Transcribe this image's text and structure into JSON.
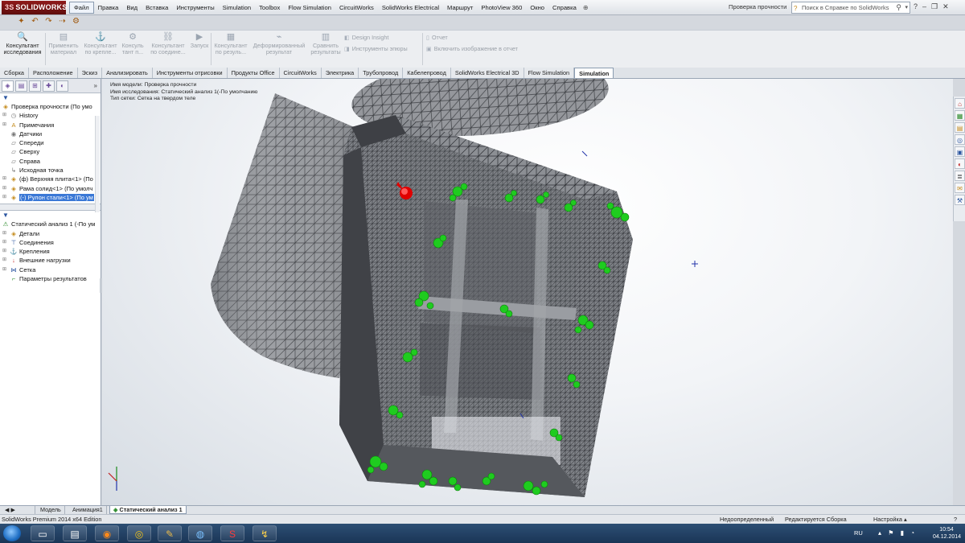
{
  "app": {
    "logo_text": "SOLIDWORKS",
    "logo_prefix": "3S",
    "document_title": "Проверка прочности",
    "help_search_placeholder": "Поиск в Справке по SolidWorks"
  },
  "menu": {
    "items": [
      "Файл",
      "Правка",
      "Вид",
      "Вставка",
      "Инструменты",
      "Simulation",
      "Toolbox",
      "Flow Simulation",
      "CircuitWorks",
      "SolidWorks Electrical",
      "Маршрут",
      "PhotoView 360",
      "Окно",
      "Справка"
    ],
    "pin": "⊕"
  },
  "ribbon": {
    "advisor": "Консультант исследования",
    "apply_material": "Применить материал",
    "fixtures_advisor": "Консультант по крепле...",
    "connections_advisor": "Консуль тант п...",
    "connections_advisor2": "Консультант по соедине...",
    "run": "Запуск",
    "results_advisor": "Консультант по резуль...",
    "deformed_result": "Деформированный результат",
    "compare_results": "Сравнить результаты",
    "design_insight": "Design Insight",
    "plot_tools": "Инструменты эпюры",
    "report": "Отчет",
    "include_image": "Включить изображение в отчет"
  },
  "command_tabs": [
    "Сборка",
    "Расположение",
    "Эскиз",
    "Анализировать",
    "Инструменты отрисовки",
    "Продукты Office",
    "CircuitWorks",
    "Электрика",
    "Трубопровод",
    "Кабелепровод",
    "SolidWorks Electrical 3D",
    "Flow Simulation",
    "Simulation"
  ],
  "active_command_tab": "Simulation",
  "feature_tree": {
    "root": "Проверка прочности  (По умо",
    "items": [
      {
        "label": "History",
        "icon": "history-icon"
      },
      {
        "label": "Примечания",
        "icon": "annotations-icon"
      },
      {
        "label": "Датчики",
        "icon": "sensors-icon"
      },
      {
        "label": "Спереди",
        "icon": "plane-icon"
      },
      {
        "label": "Сверху",
        "icon": "plane-icon"
      },
      {
        "label": "Справа",
        "icon": "plane-icon"
      },
      {
        "label": "Исходная точка",
        "icon": "origin-icon"
      },
      {
        "label": "(ф) Верхняя плита<1> (По",
        "icon": "part-icon"
      },
      {
        "label": "Рама солид<1> (По умолч",
        "icon": "part-icon"
      },
      {
        "label": "(-) Рулон стали<1> (По ум",
        "icon": "part-icon",
        "highlight": true
      }
    ]
  },
  "sim_tree": {
    "root": "Статический анализ 1 (-По ум",
    "items": [
      {
        "label": "Детали",
        "icon": "parts-icon"
      },
      {
        "label": "Соединения",
        "icon": "connections-icon"
      },
      {
        "label": "Крепления",
        "icon": "fixtures-icon"
      },
      {
        "label": "Внешние нагрузки",
        "icon": "loads-icon"
      },
      {
        "label": "Сетка",
        "icon": "mesh-icon"
      },
      {
        "label": "Параметры результатов",
        "icon": "results-options-icon"
      }
    ]
  },
  "viewport_info": {
    "model_name": "Имя модели: Проверка прочности",
    "study_name": "Имя исследования: Статический анализ 1(-По умолчанию",
    "mesh_type": "Тип сетки: Сетка на твердом теле"
  },
  "bottom_tabs": [
    "Модель",
    "Анимация1",
    "Статический анализ 1"
  ],
  "status": {
    "edition": "SolidWorks Premium 2014 x64 Edition",
    "underdefined": "Недоопределенный",
    "editing": "Редактируется Сборка",
    "settings": "Настройка"
  },
  "taskbar": {
    "lang": "RU",
    "time": "10:54",
    "date": "04.12.2014"
  },
  "colors": {
    "accent": "#3a78d6",
    "load_arrow": "#e00000",
    "fixture": "#1fcc1f",
    "mesh_fill": "#8a8d92",
    "mesh_line": "#2a2c30"
  }
}
